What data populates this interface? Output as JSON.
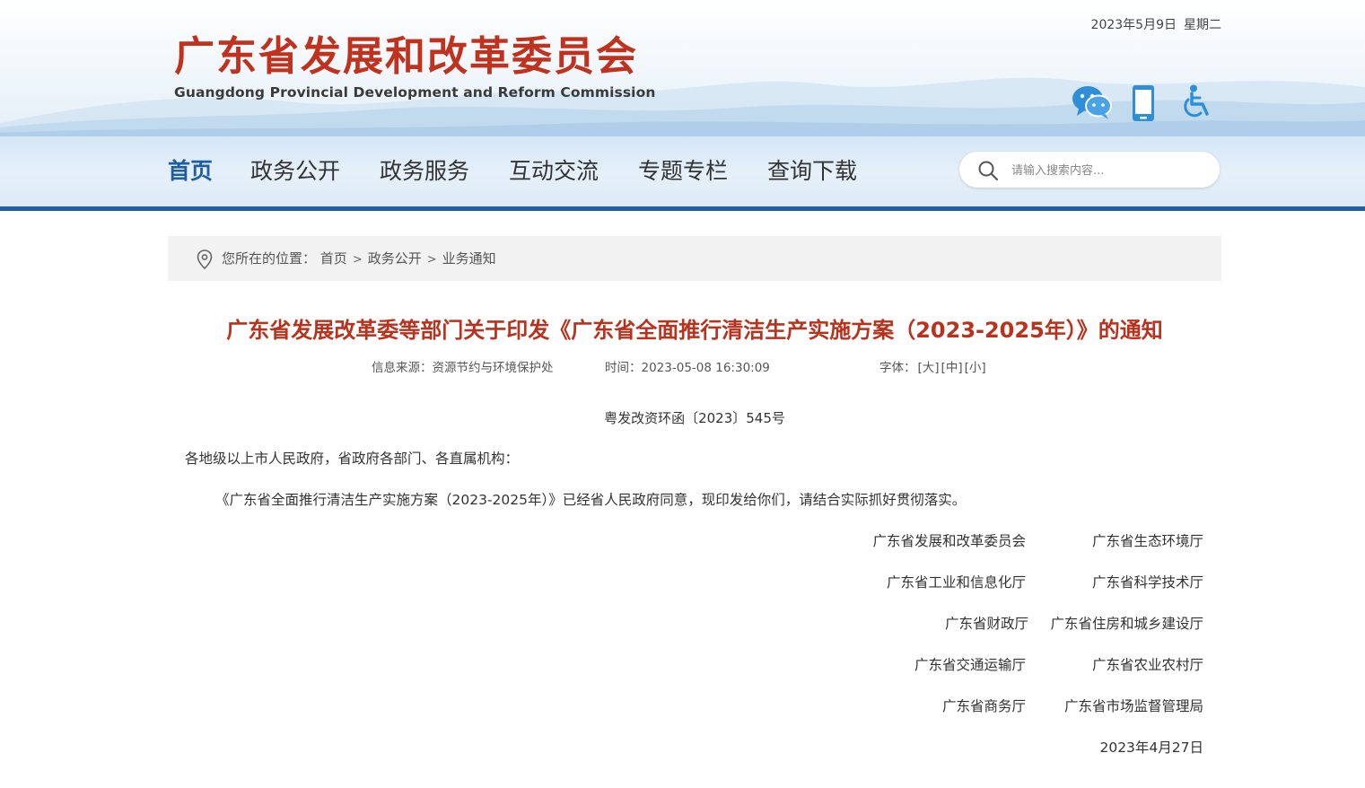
{
  "header": {
    "site_title": "广东省发展和改革委员会",
    "site_subtitle": "Guangdong Provincial Development and Reform Commission",
    "date": "2023年5月9日",
    "weekday": "星期二",
    "icons": [
      "wechat-icon",
      "mobile-icon",
      "accessibility-icon"
    ]
  },
  "nav": {
    "items": [
      {
        "label": "首页",
        "active": true
      },
      {
        "label": "政务公开",
        "active": false
      },
      {
        "label": "政务服务",
        "active": false
      },
      {
        "label": "互动交流",
        "active": false
      },
      {
        "label": "专题专栏",
        "active": false
      },
      {
        "label": "查询下载",
        "active": false
      }
    ],
    "search_placeholder": "请输入搜索内容..."
  },
  "breadcrumb": {
    "prefix": "您所在的位置：",
    "items": [
      "首页",
      "政务公开",
      "业务通知"
    ],
    "separator": ">"
  },
  "article": {
    "title": "广东省发展改革委等部门关于印发《广东省全面推行清洁生产实施方案（2023-2025年）》的通知",
    "source_label": "信息来源：",
    "source": "资源节约与环境保护处",
    "time_label": "时间：",
    "time": "2023-05-08 16:30:09",
    "font_label": "字体：",
    "font_sizes": [
      "[大]",
      "[中]",
      "[小]"
    ],
    "doc_number": "粤发改资环函〔2023〕545号",
    "salutation": "各地级以上市人民政府，省政府各部门、各直属机构：",
    "body": "《广东省全面推行清洁生产实施方案（2023-2025年）》已经省人民政府同意，现印发给你们，请结合实际抓好贯彻落实。",
    "signatories": [
      [
        "广东省发展和改革委员会",
        "广东省生态环境厅"
      ],
      [
        "广东省工业和信息化厅",
        "广东省科学技术厅"
      ],
      [
        "广东省财政厅",
        "广东省住房和城乡建设厅"
      ],
      [
        "广东省交通运输厅",
        "广东省农业农村厅"
      ],
      [
        "广东省商务厅",
        "广东省市场监督管理局"
      ]
    ],
    "sign_date": "2023年4月27日"
  },
  "colors": {
    "title_red": "#c0321d",
    "nav_blue": "#1f5ea2",
    "icon_blue": "#2e8fd8"
  }
}
